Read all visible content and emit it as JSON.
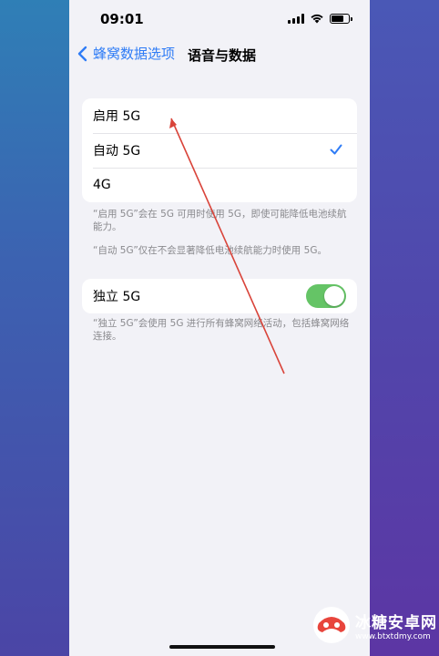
{
  "status_bar": {
    "time": "09:01",
    "battery_level": 0.7
  },
  "nav": {
    "back_label": "蜂窝数据选项",
    "title": "语音与数据",
    "back_icon": "chevron-left-icon"
  },
  "options": [
    {
      "label": "启用 5G",
      "selected": false
    },
    {
      "label": "自动 5G",
      "selected": true
    },
    {
      "label": "4G",
      "selected": false
    }
  ],
  "footnotes": {
    "enable_5g": "“启用 5G”会在 5G 可用时使用 5G，即使可能降低电池续航能力。",
    "auto_5g": "“自动 5G”仅在不会显著降低电池续航能力时使用 5G。",
    "standalone_5g": "“独立 5G”会使用 5G 进行所有蜂窝网络活动，包括蜂窝网络连接。"
  },
  "standalone": {
    "label": "独立 5G",
    "enabled": true
  },
  "watermark": {
    "title": "冰糖安卓网",
    "url": "www.btxtdmy.com"
  },
  "colors": {
    "accent": "#2f7cf6",
    "toggle_on": "#65c466",
    "annotation_line": "#d9443a",
    "watermark_red": "#e8453c"
  }
}
